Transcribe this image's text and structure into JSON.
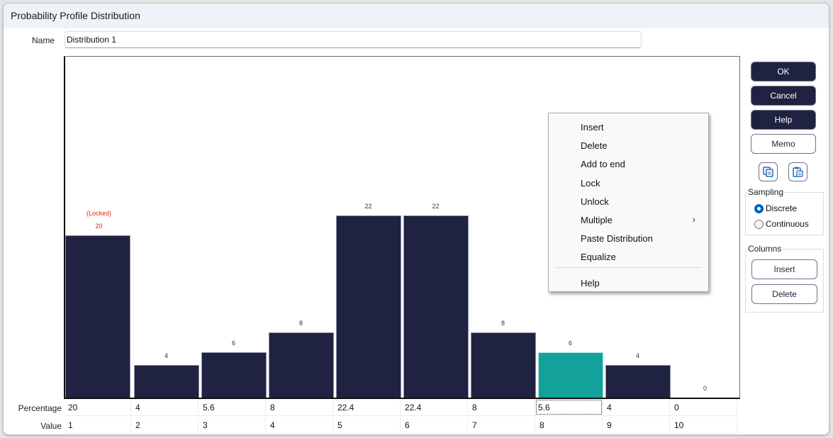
{
  "window": {
    "title": "Probability Profile Distribution"
  },
  "name": {
    "label": "Name",
    "value": "Distribution 1"
  },
  "buttons": {
    "ok": "OK",
    "cancel": "Cancel",
    "help": "Help",
    "memo": "Memo",
    "copy_icon": "copy-icon",
    "paste_icon": "paste-icon"
  },
  "sampling": {
    "legend": "Sampling",
    "options": [
      {
        "label": "Discrete",
        "selected": true
      },
      {
        "label": "Continuous",
        "selected": false
      }
    ]
  },
  "columns": {
    "legend": "Columns",
    "insert": "Insert",
    "delete": "Delete"
  },
  "context_menu": {
    "items": [
      {
        "label": "Insert"
      },
      {
        "label": "Delete"
      },
      {
        "label": "Add to end"
      },
      {
        "label": "Lock"
      },
      {
        "label": "Unlock"
      },
      {
        "label": "Multiple",
        "submenu": true,
        "chevron": "›"
      },
      {
        "label": "Paste Distribution"
      },
      {
        "label": "Equalize"
      },
      {
        "label": "Help",
        "after_separator": true
      }
    ]
  },
  "table": {
    "percentage_label": "Percentage",
    "value_label": "Value",
    "focused_column": 7
  },
  "colors": {
    "bar": "#1f2240",
    "selected_bar": "#13a19b",
    "locked_label": "#e0241b"
  },
  "chart_data": {
    "type": "bar",
    "title": "",
    "xlabel": "Value",
    "ylabel": "Percentage",
    "categories": [
      "1",
      "2",
      "3",
      "4",
      "5",
      "6",
      "7",
      "8",
      "9",
      "10"
    ],
    "values": [
      20,
      4,
      5.6,
      8,
      22.4,
      22.4,
      8,
      5.6,
      4,
      0
    ],
    "bar_labels": [
      "20",
      "4",
      "6",
      "8",
      "22",
      "22",
      "8",
      "6",
      "4",
      "0"
    ],
    "locked": [
      0
    ],
    "locked_text": "(Locked)",
    "selected": 7,
    "ylim": [
      0,
      42
    ],
    "grid": false
  }
}
